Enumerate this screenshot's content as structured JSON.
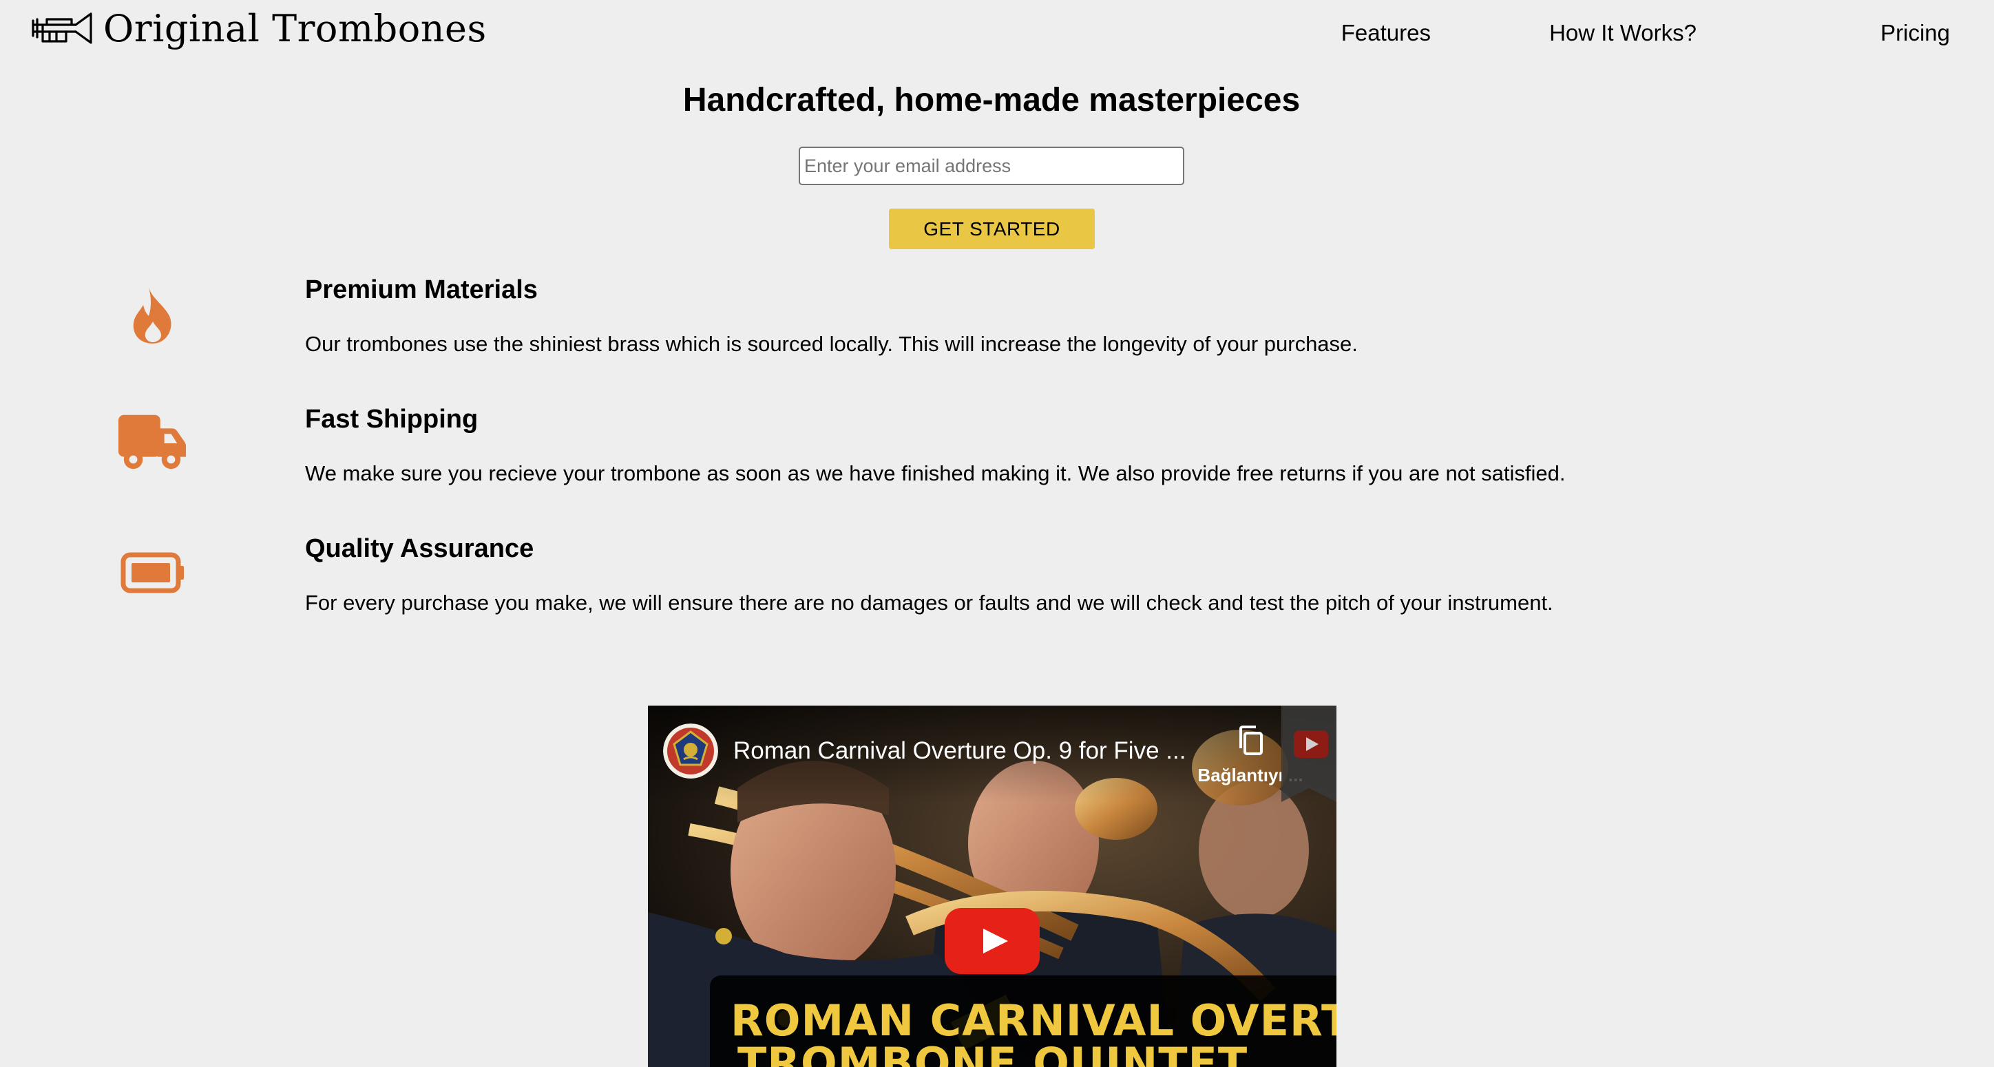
{
  "brand": {
    "name": "Original Trombones",
    "logo_icon": "trombone-icon"
  },
  "nav": {
    "items": [
      {
        "label": "Features"
      },
      {
        "label": "How It Works?"
      },
      {
        "label": "Pricing"
      }
    ]
  },
  "hero": {
    "title": "Handcrafted, home-made masterpieces",
    "email_placeholder": "Enter your email address",
    "email_value": "",
    "cta_label": "GET STARTED"
  },
  "features": [
    {
      "icon": "fire-icon",
      "title": "Premium Materials",
      "description": "Our trombones use the shiniest brass which is sourced locally. This will increase the longevity of your purchase."
    },
    {
      "icon": "truck-icon",
      "title": "Fast Shipping",
      "description": "We make sure you recieve your trombone as soon as we have finished making it. We also provide free returns if you are not satisfied."
    },
    {
      "icon": "battery-full-icon",
      "title": "Quality Assurance",
      "description": "For every purchase you make, we will ensure there are no damages or faults and we will check and test the pitch of your instrument."
    }
  ],
  "video": {
    "title": "Roman Carnival Overture Op. 9 for Five ...",
    "copy_link_label": "Bağlantıyı ...",
    "caption_line1": "ROMAN CARNIVAL OVERTURE",
    "caption_line2": "TROMBONE QUINTET"
  },
  "colors": {
    "background": "#eeeeee",
    "accent_icon": "#e07a3a",
    "cta": "#e9c644",
    "youtube_red": "#e62117"
  }
}
